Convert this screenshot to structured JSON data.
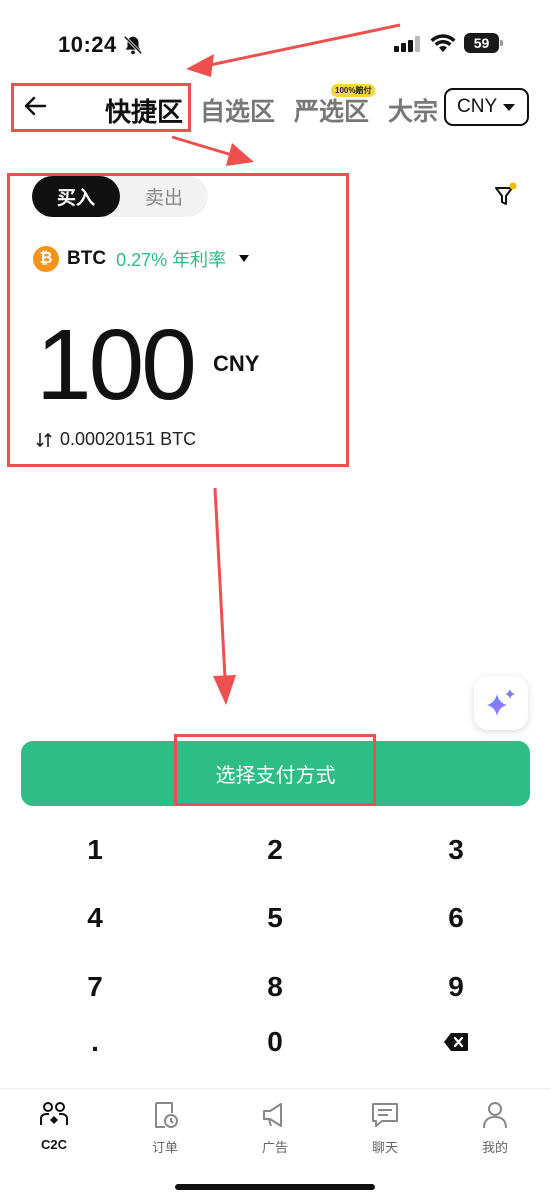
{
  "status_bar": {
    "time": "10:24",
    "battery": "59",
    "icons": [
      "bell-slash-icon",
      "signal-icon",
      "wifi-icon",
      "battery-icon"
    ]
  },
  "nav": {
    "back_icon": "arrow-left-icon",
    "tabs": [
      {
        "label": "快捷区",
        "active": true
      },
      {
        "label": "自选区",
        "active": false
      },
      {
        "label": "严选区",
        "active": false,
        "badge": "100%赔付"
      },
      {
        "label": "大宗",
        "active": false
      }
    ],
    "currency": "CNY"
  },
  "trade": {
    "buy_label": "买入",
    "sell_label": "卖出",
    "filter_icon": "filter-icon",
    "coin": "BTC",
    "coin_symbol": "₿",
    "rate": "0.27% 年利率",
    "amount": "100",
    "amount_unit": "CNY",
    "converted": "0.00020151 BTC"
  },
  "action": {
    "button_label": "选择支付方式"
  },
  "keypad": {
    "keys": [
      "1",
      "2",
      "3",
      "4",
      "5",
      "6",
      "7",
      "8",
      "9",
      ".",
      "0"
    ]
  },
  "tabbar": {
    "items": [
      {
        "label": "C2C",
        "icon": "c2c-icon",
        "active": true
      },
      {
        "label": "订单",
        "icon": "order-icon",
        "active": false
      },
      {
        "label": "广告",
        "icon": "megaphone-icon",
        "active": false
      },
      {
        "label": "聊天",
        "icon": "chat-icon",
        "active": false
      },
      {
        "label": "我的",
        "icon": "user-icon",
        "active": false
      }
    ]
  },
  "colors": {
    "accent_green": "#2ebd85",
    "annotation_red": "#ee4f4f",
    "btc_orange": "#f7931a",
    "badge_yellow": "#f5d93b"
  }
}
